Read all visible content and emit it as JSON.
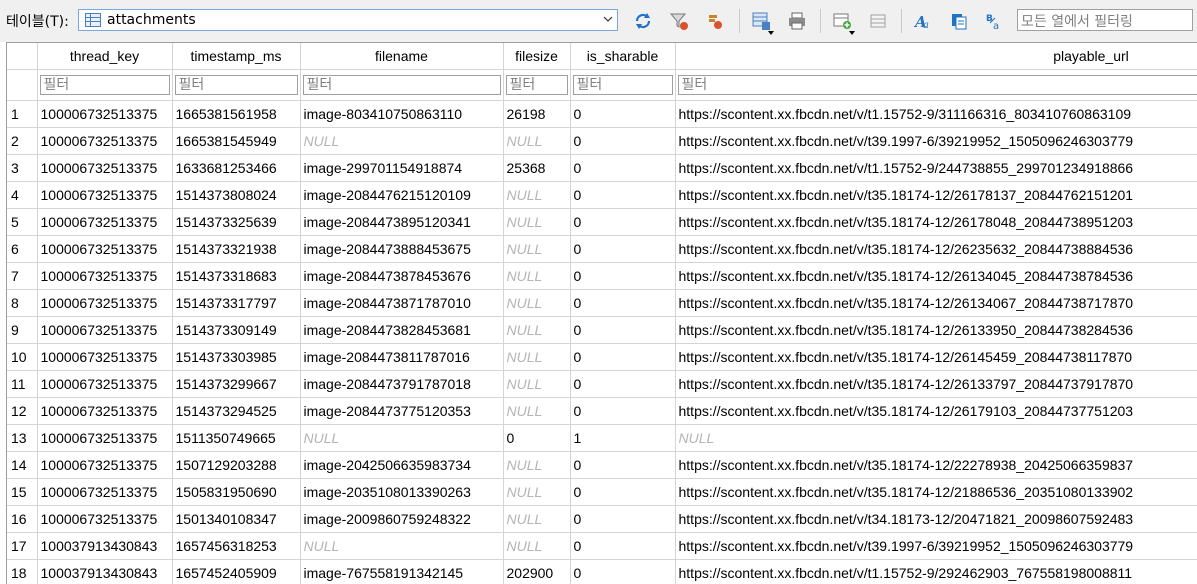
{
  "toolbar": {
    "table_label": "테이블(T):",
    "table_value": "attachments",
    "filter_all_placeholder": "모든 열에서 필터링",
    "icons": [
      "refresh-icon",
      "clear-filters-icon",
      "clear-sort-icon",
      "save-filter-icon",
      "print-icon",
      "new-record-icon",
      "delete-record-icon",
      "font-icon",
      "format-icon",
      "encoding-icon"
    ]
  },
  "grid": {
    "columns": [
      "thread_key",
      "timestamp_ms",
      "filename",
      "filesize",
      "is_sharable",
      "playable_url"
    ],
    "filter_placeholder": "필터",
    "null_text": "NULL",
    "rows": [
      {
        "n": "1",
        "thread_key": "100006732513375",
        "timestamp_ms": "1665381561958",
        "filename": "image-803410750863110",
        "filesize": "26198",
        "is_sharable": "0",
        "playable_url": "https://scontent.xx.fbcdn.net/v/t1.15752-9/311166316_803410760863109"
      },
      {
        "n": "2",
        "thread_key": "100006732513375",
        "timestamp_ms": "1665381545949",
        "filename": null,
        "filesize": null,
        "is_sharable": "0",
        "playable_url": "https://scontent.xx.fbcdn.net/v/t39.1997-6/39219952_1505096246303779"
      },
      {
        "n": "3",
        "thread_key": "100006732513375",
        "timestamp_ms": "1633681253466",
        "filename": "image-299701154918874",
        "filesize": "25368",
        "is_sharable": "0",
        "playable_url": "https://scontent.xx.fbcdn.net/v/t1.15752-9/244738855_299701234918866"
      },
      {
        "n": "4",
        "thread_key": "100006732513375",
        "timestamp_ms": "1514373808024",
        "filename": "image-2084476215120109",
        "filesize": null,
        "is_sharable": "0",
        "playable_url": "https://scontent.xx.fbcdn.net/v/t35.18174-12/26178137_20844762151201"
      },
      {
        "n": "5",
        "thread_key": "100006732513375",
        "timestamp_ms": "1514373325639",
        "filename": "image-2084473895120341",
        "filesize": null,
        "is_sharable": "0",
        "playable_url": "https://scontent.xx.fbcdn.net/v/t35.18174-12/26178048_20844738951203"
      },
      {
        "n": "6",
        "thread_key": "100006732513375",
        "timestamp_ms": "1514373321938",
        "filename": "image-2084473888453675",
        "filesize": null,
        "is_sharable": "0",
        "playable_url": "https://scontent.xx.fbcdn.net/v/t35.18174-12/26235632_20844738884536"
      },
      {
        "n": "7",
        "thread_key": "100006732513375",
        "timestamp_ms": "1514373318683",
        "filename": "image-2084473878453676",
        "filesize": null,
        "is_sharable": "0",
        "playable_url": "https://scontent.xx.fbcdn.net/v/t35.18174-12/26134045_20844738784536"
      },
      {
        "n": "8",
        "thread_key": "100006732513375",
        "timestamp_ms": "1514373317797",
        "filename": "image-2084473871787010",
        "filesize": null,
        "is_sharable": "0",
        "playable_url": "https://scontent.xx.fbcdn.net/v/t35.18174-12/26134067_20844738717870"
      },
      {
        "n": "9",
        "thread_key": "100006732513375",
        "timestamp_ms": "1514373309149",
        "filename": "image-2084473828453681",
        "filesize": null,
        "is_sharable": "0",
        "playable_url": "https://scontent.xx.fbcdn.net/v/t35.18174-12/26133950_20844738284536"
      },
      {
        "n": "10",
        "thread_key": "100006732513375",
        "timestamp_ms": "1514373303985",
        "filename": "image-2084473811787016",
        "filesize": null,
        "is_sharable": "0",
        "playable_url": "https://scontent.xx.fbcdn.net/v/t35.18174-12/26145459_20844738117870"
      },
      {
        "n": "11",
        "thread_key": "100006732513375",
        "timestamp_ms": "1514373299667",
        "filename": "image-2084473791787018",
        "filesize": null,
        "is_sharable": "0",
        "playable_url": "https://scontent.xx.fbcdn.net/v/t35.18174-12/26133797_20844737917870"
      },
      {
        "n": "12",
        "thread_key": "100006732513375",
        "timestamp_ms": "1514373294525",
        "filename": "image-2084473775120353",
        "filesize": null,
        "is_sharable": "0",
        "playable_url": "https://scontent.xx.fbcdn.net/v/t35.18174-12/26179103_20844737751203"
      },
      {
        "n": "13",
        "thread_key": "100006732513375",
        "timestamp_ms": "1511350749665",
        "filename": null,
        "filesize": "0",
        "is_sharable": "1",
        "playable_url": null
      },
      {
        "n": "14",
        "thread_key": "100006732513375",
        "timestamp_ms": "1507129203288",
        "filename": "image-2042506635983734",
        "filesize": null,
        "is_sharable": "0",
        "playable_url": "https://scontent.xx.fbcdn.net/v/t35.18174-12/22278938_20425066359837"
      },
      {
        "n": "15",
        "thread_key": "100006732513375",
        "timestamp_ms": "1505831950690",
        "filename": "image-2035108013390263",
        "filesize": null,
        "is_sharable": "0",
        "playable_url": "https://scontent.xx.fbcdn.net/v/t35.18174-12/21886536_20351080133902"
      },
      {
        "n": "16",
        "thread_key": "100006732513375",
        "timestamp_ms": "1501340108347",
        "filename": "image-2009860759248322",
        "filesize": null,
        "is_sharable": "0",
        "playable_url": "https://scontent.xx.fbcdn.net/v/t34.18173-12/20471821_20098607592483"
      },
      {
        "n": "17",
        "thread_key": "100037913430843",
        "timestamp_ms": "1657456318253",
        "filename": null,
        "filesize": null,
        "is_sharable": "0",
        "playable_url": "https://scontent.xx.fbcdn.net/v/t39.1997-6/39219952_1505096246303779"
      },
      {
        "n": "18",
        "thread_key": "100037913430843",
        "timestamp_ms": "1657452405909",
        "filename": "image-767558191342145",
        "filesize": "202900",
        "is_sharable": "0",
        "playable_url": "https://scontent.xx.fbcdn.net/v/t1.15752-9/292462903_767558198008811"
      }
    ]
  }
}
